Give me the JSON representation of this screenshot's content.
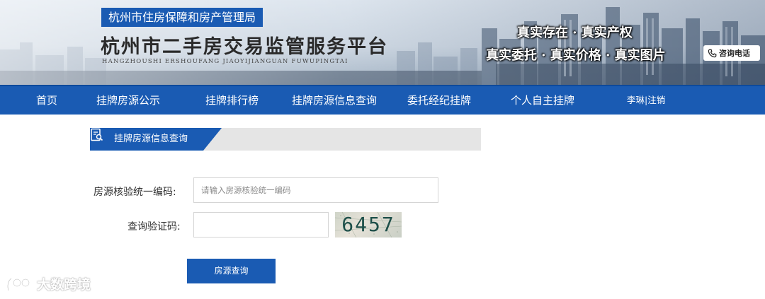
{
  "header": {
    "agency": "杭州市住房保障和房产管理局",
    "platform_title": "杭州市二手房交易监管服务平台",
    "platform_pinyin": "HANGZHOUSHI ERSHOUFANG JIAOYIJIANGUAN FUWUPINGTAI",
    "slogan_line1": "真实存在 · 真实产权",
    "slogan_line2": "真实委托 · 真实价格 · 真实图片",
    "consult_label": "咨询电话"
  },
  "nav": {
    "items": [
      "首页",
      "挂牌房源公示",
      "挂牌排行榜",
      "挂牌房源信息查询",
      "委托经纪挂牌",
      "个人自主挂牌"
    ],
    "user": "李琳|注销"
  },
  "section": {
    "title": "挂牌房源信息查询"
  },
  "form": {
    "code_label": "房源核验统一编码:",
    "code_placeholder": "请输入房源核验统一编码",
    "code_value": "",
    "captcha_label": "查询验证码:",
    "captcha_value": "",
    "captcha_image_text": "6457",
    "submit_label": "房源查询"
  },
  "watermark": {
    "text": "大数跨境"
  },
  "colors": {
    "primary": "#1a5bb3",
    "section_bg": "#e5e5e5",
    "text": "#333333"
  }
}
